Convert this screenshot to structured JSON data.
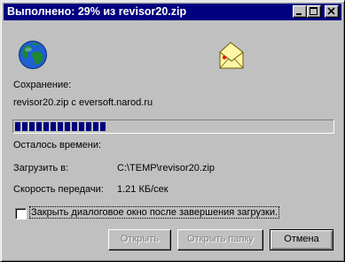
{
  "window": {
    "title": "Выполнено: 29% из revisor20.zip",
    "minimize_icon": "minimize-icon",
    "maximize_icon": "maximize-icon",
    "close_icon": "close-icon"
  },
  "icons": {
    "source": "globe-icon",
    "destination": "folder-icon"
  },
  "status": {
    "saving_label": "Сохранение:",
    "file_source": "revisor20.zip с eversoft.narod.ru"
  },
  "progress": {
    "percent": 29,
    "bar_color": "#000080"
  },
  "details": {
    "time_left_label": "Осталось времени:",
    "download_to_label": "Загрузить в:",
    "download_to_value": "C:\\TEMP\\revisor20.zip",
    "speed_label": "Скорость передачи:",
    "speed_value": "1.21 КБ/сек"
  },
  "options": {
    "close_after_label": "Закрыть диалоговое окно после завершения загрузки.",
    "close_after_checked": false
  },
  "buttons": {
    "open_label": "Открыть",
    "open_enabled": false,
    "open_folder_label": "Открыть папку",
    "open_folder_enabled": false,
    "cancel_label": "Отмена",
    "cancel_enabled": true
  }
}
